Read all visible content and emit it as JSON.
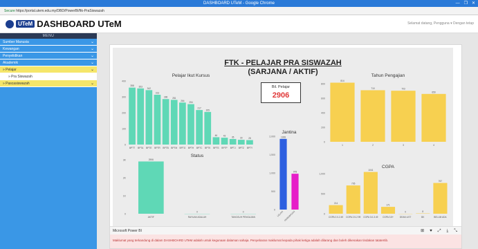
{
  "window": {
    "title": "DASHBOARD UTeM - Google Chrome",
    "controls": [
      "—",
      "❐",
      "✕"
    ]
  },
  "address": {
    "secure_label": "Secure",
    "url": "https://portal.utem.edu.my/DBD/PowerBI/ftk-PraSiswazah"
  },
  "header": {
    "logo_badge": "UTeM",
    "title": "DASHBOARD UTeM",
    "user": "Selamat datang, Pengguna ▾   Dengan tetap"
  },
  "sidebar": {
    "menu_heading": "MENU",
    "items": [
      {
        "label": "Sumber Manusia",
        "chevron": "⌄"
      },
      {
        "label": "Kewangan",
        "chevron": "⌄"
      },
      {
        "label": "Penyelidikan",
        "chevron": "⌄"
      },
      {
        "label": "Akademik",
        "chevron": "⌄"
      },
      {
        "label": "» Pelajar",
        "chevron": "⌄"
      },
      {
        "label": "» Pra Siswazah",
        "chevron": ""
      },
      {
        "label": "» Pascasiswazah",
        "chevron": "⌄"
      }
    ]
  },
  "report": {
    "title_line1": "FTK - PELAJAR PRA SISWAZAH",
    "title_line2": "(SARJANA / AKTIF)",
    "card_title": "Bil. Pelajar",
    "card_value": "2906",
    "pbi_label": "Microsoft Power BI",
    "pbi_icons": [
      "⊞",
      "♥",
      "⤢",
      "⤓",
      "⤡"
    ],
    "notice": "Maklumat yang terkandung di dalam DASHBOARD UTeM adalah untuk kegunaan dalaman sahaja. Penyebaran maklumat kepada pihak ketiga adalah dilarang dan boleh dikenakan tindakan tatatertib."
  },
  "chart_data": [
    {
      "type": "bar",
      "title": "Pelajar Ikut Kursus",
      "categories": [
        "BPTT",
        "BPTA",
        "BPTE",
        "BPTR",
        "BPTB",
        "BPTM",
        "BPTG",
        "BPTH",
        "BPTC",
        "BPTK",
        "BPTS",
        "BPTP",
        "BPTJ",
        "BPTZ",
        "BPTY"
      ],
      "values": [
        358,
        353,
        342,
        313,
        286,
        281,
        264,
        254,
        217,
        205,
        46,
        43,
        35,
        30,
        28
      ],
      "ylim": [
        0,
        400
      ],
      "yticks": [
        "0",
        "100",
        "200",
        "300",
        "400"
      ],
      "color": "#5fd8b6"
    },
    {
      "type": "bar",
      "title": "Tahun Pengajian",
      "categories": [
        "1",
        "2",
        "3",
        "4"
      ],
      "values": [
        814,
        710,
        703,
        659
      ],
      "ylim": [
        0,
        800
      ],
      "yticks": [
        "0",
        "200",
        "400",
        "600",
        "800"
      ],
      "color": "#f7d050"
    },
    {
      "type": "bar",
      "title": "Status",
      "categories": [
        "AKTIF",
        "RAYUAN ADALAH",
        "TANGGUH PENGAJIAN"
      ],
      "values": [
        2906,
        0,
        0
      ],
      "ylim": [
        0,
        3000
      ],
      "yticks": [
        "0",
        "1K",
        "2K",
        "3K"
      ],
      "color": "#5fd8b6"
    },
    {
      "type": "bar",
      "title": "Jantina",
      "categories": [
        "LELAKI",
        "PEREMPUAN"
      ],
      "values": [
        1928,
        978
      ],
      "ylim": [
        0,
        2000
      ],
      "yticks": [
        "0",
        "500",
        "1,000",
        "1,500",
        "2,000"
      ],
      "colors": [
        "#2d5fe0",
        "#e61ec8"
      ]
    },
    {
      "type": "bar",
      "title": "CGPA",
      "categories": [
        "CGPA 2.0-2.49",
        "CGPA 2.5-2.99",
        "CGPA 3.0-3.49",
        "CGPA 3.5+",
        "DEAN LIST",
        "BK",
        "BELUM ADA"
      ],
      "values": [
        214,
        705,
        1041,
        171,
        0,
        8,
        767
      ],
      "ylim": [
        0,
        1000
      ],
      "yticks": [
        "0",
        "500",
        "1,000"
      ],
      "color": "#f7d050"
    }
  ]
}
